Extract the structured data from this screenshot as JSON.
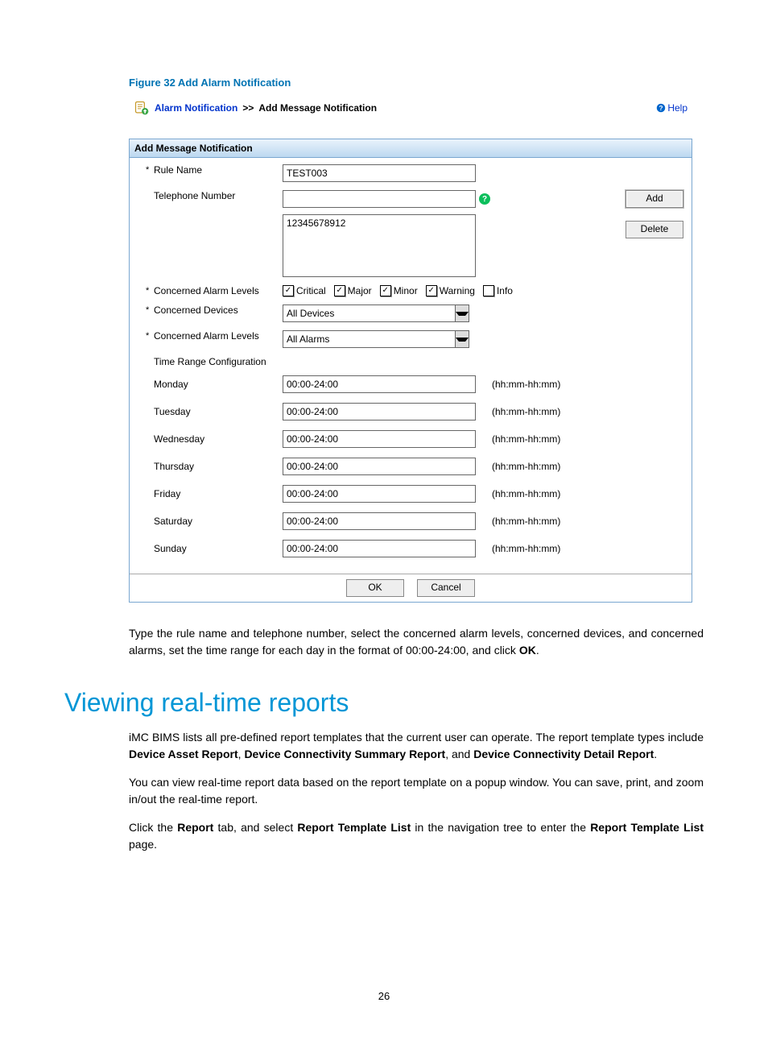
{
  "figure_caption": "Figure 32 Add Alarm Notification",
  "breadcrumb": {
    "link": "Alarm Notification",
    "sep": ">>",
    "current": "Add Message Notification"
  },
  "help_label": "Help",
  "panel_title": "Add Message Notification",
  "labels": {
    "rule_name": "Rule Name",
    "telephone": "Telephone Number",
    "alarm_levels": "Concerned Alarm Levels",
    "devices": "Concerned Devices",
    "alarm_levels2": "Concerned Alarm Levels",
    "time_range": "Time Range Configuration"
  },
  "values": {
    "rule_name": "TEST003",
    "telephone_list": "12345678912",
    "devices": "All Devices",
    "alarms": "All Alarms"
  },
  "buttons": {
    "add": "Add",
    "delete": "Delete",
    "ok": "OK",
    "cancel": "Cancel"
  },
  "alarm_levels": [
    {
      "label": "Critical",
      "checked": true
    },
    {
      "label": "Major",
      "checked": true
    },
    {
      "label": "Minor",
      "checked": true
    },
    {
      "label": "Warning",
      "checked": true
    },
    {
      "label": "Info",
      "checked": false
    }
  ],
  "time_hint": "(hh:mm-hh:mm)",
  "days": [
    {
      "name": "Monday",
      "value": "00:00-24:00"
    },
    {
      "name": "Tuesday",
      "value": "00:00-24:00"
    },
    {
      "name": "Wednesday",
      "value": "00:00-24:00"
    },
    {
      "name": "Thursday",
      "value": "00:00-24:00"
    },
    {
      "name": "Friday",
      "value": "00:00-24:00"
    },
    {
      "name": "Saturday",
      "value": "00:00-24:00"
    },
    {
      "name": "Sunday",
      "value": "00:00-24:00"
    }
  ],
  "paragraph1_a": "Type the rule name and telephone number, select the concerned alarm levels, concerned devices, and concerned alarms, set the time range for each day in the format of 00:00-24:00, and click ",
  "paragraph1_b": "OK",
  "paragraph1_c": ".",
  "heading2": "Viewing real-time reports",
  "p2a": "iMC BIMS lists all pre-defined report templates that the current user can operate. The report template types include ",
  "p2b": "Device Asset Report",
  "p2c": ", ",
  "p2d": "Device Connectivity Summary Report",
  "p2e": ", and ",
  "p2f": "Device Connectivity Detail Report",
  "p2g": ".",
  "p3": "You can view real-time report data based on the report template on a popup window. You can save, print, and zoom in/out the real-time report.",
  "p4a": "Click the ",
  "p4b": "Report",
  "p4c": " tab, and select ",
  "p4d": "Report Template List",
  "p4e": " in the navigation tree to enter the ",
  "p4f": "Report Template List",
  "p4g": " page.",
  "page_number": "26"
}
